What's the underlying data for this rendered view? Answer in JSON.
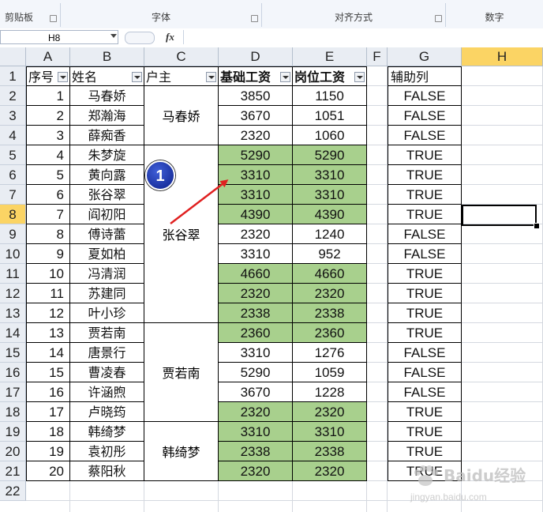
{
  "ribbon": {
    "groups": [
      {
        "label": "剪贴板"
      },
      {
        "label": "字体"
      },
      {
        "label": "对齐方式"
      },
      {
        "label": "数字"
      }
    ]
  },
  "formula_bar": {
    "name_box": "H8",
    "fx_label": "fx",
    "formula": ""
  },
  "columns": [
    "A",
    "B",
    "C",
    "D",
    "E",
    "F",
    "G",
    "H"
  ],
  "selected_column": "H",
  "rows": [
    "1",
    "2",
    "3",
    "4",
    "5",
    "6",
    "7",
    "8",
    "9",
    "10",
    "11",
    "12",
    "13",
    "14",
    "15",
    "16",
    "17",
    "18",
    "19",
    "20",
    "21",
    "22"
  ],
  "selected_row": "8",
  "headers": {
    "seq": "序号",
    "name": "姓名",
    "host": "户主",
    "base_salary": "基础工资",
    "post_salary": "岗位工资",
    "helper": "辅助列"
  },
  "records": [
    {
      "seq": "1",
      "name": "马春娇",
      "base": "3850",
      "post": "1150",
      "helper": "FALSE",
      "highlight": false
    },
    {
      "seq": "2",
      "name": "郑瀚海",
      "base": "3670",
      "post": "1051",
      "helper": "FALSE",
      "highlight": false
    },
    {
      "seq": "3",
      "name": "薛痴香",
      "base": "2320",
      "post": "1060",
      "helper": "FALSE",
      "highlight": false
    },
    {
      "seq": "4",
      "name": "朱梦旋",
      "base": "5290",
      "post": "5290",
      "helper": "TRUE",
      "highlight": true
    },
    {
      "seq": "5",
      "name": "黄向露",
      "base": "3310",
      "post": "3310",
      "helper": "TRUE",
      "highlight": true
    },
    {
      "seq": "6",
      "name": "张谷翠",
      "base": "3310",
      "post": "3310",
      "helper": "TRUE",
      "highlight": true
    },
    {
      "seq": "7",
      "name": "阎初阳",
      "base": "4390",
      "post": "4390",
      "helper": "TRUE",
      "highlight": true
    },
    {
      "seq": "8",
      "name": "傅诗蕾",
      "base": "2320",
      "post": "1240",
      "helper": "FALSE",
      "highlight": false
    },
    {
      "seq": "9",
      "name": "夏如柏",
      "base": "3310",
      "post": "952",
      "helper": "FALSE",
      "highlight": false
    },
    {
      "seq": "10",
      "name": "冯清润",
      "base": "4660",
      "post": "4660",
      "helper": "TRUE",
      "highlight": true
    },
    {
      "seq": "11",
      "name": "苏建同",
      "base": "2320",
      "post": "2320",
      "helper": "TRUE",
      "highlight": true
    },
    {
      "seq": "12",
      "name": "叶小珍",
      "base": "2338",
      "post": "2338",
      "helper": "TRUE",
      "highlight": true
    },
    {
      "seq": "13",
      "name": "贾若南",
      "base": "2360",
      "post": "2360",
      "helper": "TRUE",
      "highlight": true
    },
    {
      "seq": "14",
      "name": "唐景行",
      "base": "3310",
      "post": "1276",
      "helper": "FALSE",
      "highlight": false
    },
    {
      "seq": "15",
      "name": "曹凌春",
      "base": "5290",
      "post": "1059",
      "helper": "FALSE",
      "highlight": false
    },
    {
      "seq": "16",
      "name": "许涵煦",
      "base": "3670",
      "post": "1228",
      "helper": "FALSE",
      "highlight": false
    },
    {
      "seq": "17",
      "name": "卢晓筠",
      "base": "2320",
      "post": "2320",
      "helper": "TRUE",
      "highlight": true
    },
    {
      "seq": "18",
      "name": "韩绮梦",
      "base": "3310",
      "post": "3310",
      "helper": "TRUE",
      "highlight": true
    },
    {
      "seq": "19",
      "name": "袁初彤",
      "base": "2338",
      "post": "2338",
      "helper": "TRUE",
      "highlight": true
    },
    {
      "seq": "20",
      "name": "蔡阳秋",
      "base": "2320",
      "post": "2320",
      "helper": "TRUE",
      "highlight": true
    }
  ],
  "host_groups": [
    {
      "name": "马春娇"
    },
    {
      "name": "张谷翠"
    },
    {
      "name": "贾若南"
    },
    {
      "name": "韩绮梦"
    }
  ],
  "annotation": {
    "badge": "1",
    "arrow_color": "#e02020"
  },
  "colors": {
    "highlight": "#a8d08d",
    "selected_header": "#fbd464"
  },
  "watermark": {
    "text": "Baidu经验",
    "url": "jingyan.baidu.com"
  }
}
